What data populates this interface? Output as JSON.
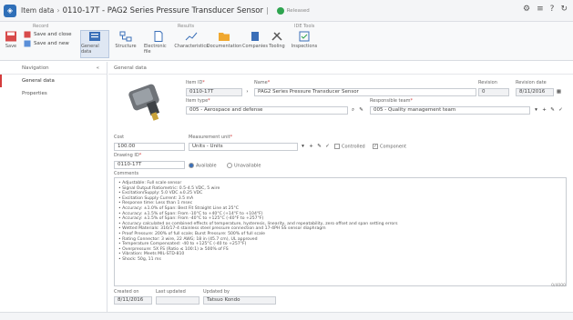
{
  "titlebar": {
    "breadcrumb": "Item data",
    "title": "0110-17T - PAG2 Series Pressure Transducer Sensor",
    "status_text": "Released",
    "status_color": "#2ea44f",
    "icons": [
      "settings-icon",
      "menu-icon",
      "help-icon",
      "refresh-icon"
    ]
  },
  "ribbon": {
    "groups": [
      "Record",
      "Results",
      "IDE Tools"
    ],
    "save_label": "Save",
    "save_close": "Save and close",
    "save_new": "Save and new",
    "buttons": [
      "General data",
      "Structure",
      "Electronic file",
      "Characteristics",
      "Documentation",
      "Companies",
      "Tooling",
      "Inspections"
    ]
  },
  "sidebar": {
    "header": "Navigation",
    "items": [
      {
        "label": "General data",
        "active": true
      },
      {
        "label": "Properties",
        "active": false
      }
    ]
  },
  "main": {
    "header": "General data",
    "item_id_label": "Item ID",
    "item_id": "0110-17T",
    "name_label": "Name",
    "name": "PAG2 Series Pressure Transducer Sensor",
    "revision_label": "Revision",
    "revision": "0",
    "revision_date_label": "Revision date",
    "revision_date": "8/11/2016",
    "item_type_label": "Item type",
    "item_type": "005 - Aerospace and defense",
    "responsible_label": "Responsible team",
    "responsible": "005 - Quality management team",
    "cost_label": "Cost",
    "cost": "100.00",
    "uom_label": "Measurement unit",
    "uom": "Units - Units",
    "controlled_label": "Controlled",
    "component_label": "Component",
    "drawing_label": "Drawing ID",
    "drawing": "0110-17T",
    "radio_a": "Available",
    "radio_b": "Unavailable",
    "comments_label": "Comments",
    "comments": [
      "• Adjustable: Full scale sensor",
      "• Signal Output Ratiometric: 0.5-4.5 VDC, 5 wire",
      "• Excitation/Supply: 5.0 VDC ±0.25 VDC",
      "• Excitation Supply Current: 3.5 mA",
      "• Response time: Less than 1 msec",
      "• Accuracy: ±1.0% of Span: Best Fit Straight Line at 25°C",
      "• Accuracy: ±1.5% of Span: From -10°C to +40°C (+14°F to +104°F)",
      "• Accuracy: ±1.5% of Span: From -40°C to +125°C (-40°F to +257°F)",
      "• Accuracy calculated as combined effects of temperature, hysteresis, linearity, and repeatability, zero offset and span setting errors",
      "• Wetted Materials: 316/17-4 stainless steel pressure connection and 17-4PH SS sensor diaphragm",
      "• Proof Pressure: 200% of full scale; Burst Pressure: 500% of full scale",
      "• Rating Connector: 3 wire, 22 AWG; 18 in (45.7 cm), UL approved",
      "• Temperature Compensated: -40 to +125°C (-40 to +257°F)",
      "• Overpressure: 5X FS (Ratio ≤ 100:1) ≥ 500% of FS",
      "• Vibration: Meets MIL-STD-810",
      "• Shock: 50g, 11 ms"
    ],
    "char_count": "0/4000",
    "created_label": "Created on",
    "created": "8/11/2016",
    "updated_label": "Last updated",
    "updated_by_label": "Updated by",
    "updated_by": "Tatsuo Kondo"
  }
}
